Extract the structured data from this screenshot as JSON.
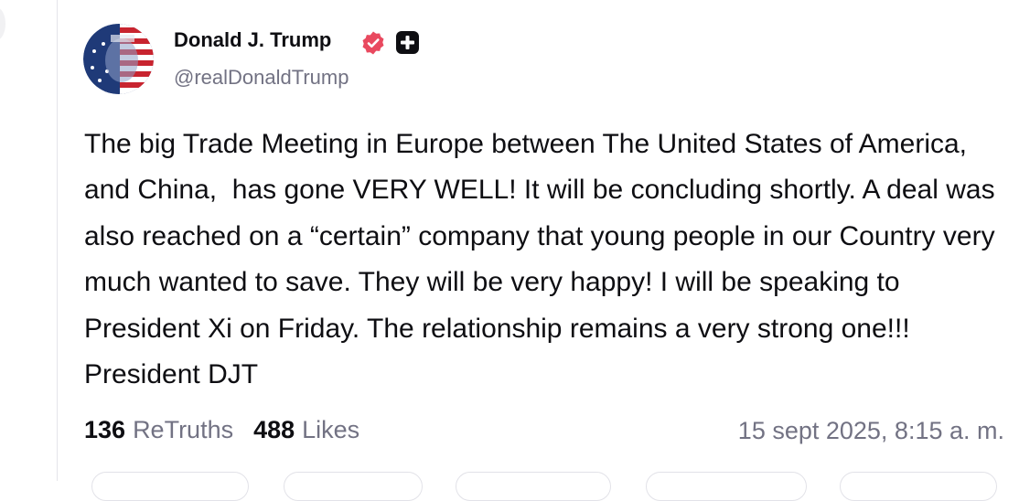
{
  "post": {
    "author": {
      "display_name": "Donald J. Trump",
      "handle": "@realDonaldTrump",
      "verified": true,
      "verified_color": "#e9495f",
      "plus_badge_color": "#0e0e12"
    },
    "body": "The big Trade Meeting in Europe between The United States of America, and China,  has gone VERY WELL! It will be concluding shortly. A deal was also reached on a “certain” company that young people in our Country very much wanted to save. They will be very happy! I will be speaking to President Xi on Friday. The relationship remains a very strong one!!! President DJT",
    "stats": {
      "retruths_count": "136",
      "retruths_label": "ReTruths",
      "likes_count": "488",
      "likes_label": "Likes"
    },
    "timestamp": "15 sept 2025, 8:15 a. m."
  },
  "icons": {
    "avatar": "avatar-flag-portrait",
    "verified": "verified-badge-icon",
    "plus": "plus-badge-icon"
  }
}
